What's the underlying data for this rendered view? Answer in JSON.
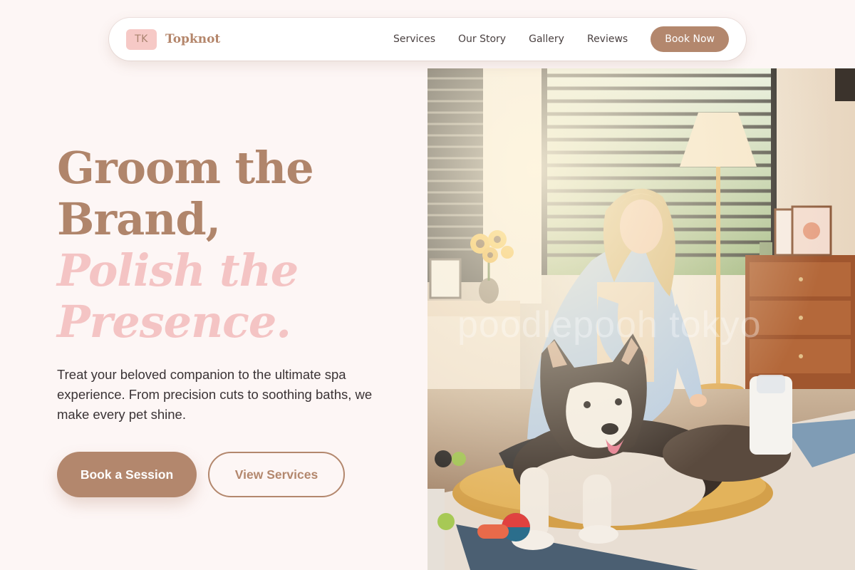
{
  "brand": {
    "badge": "TK",
    "name": "Topknot"
  },
  "nav": {
    "links": [
      "Services",
      "Our Story",
      "Gallery",
      "Reviews"
    ],
    "cta": "Book Now"
  },
  "hero": {
    "headline_line1": "Groom the",
    "headline_line2": "Brand,",
    "headline_line3": "Polish the",
    "headline_line4": "Presence.",
    "subtitle": "Treat your beloved companion to the ultimate spa experience. From precision cuts to soothing baths, we make every pet shine.",
    "primary_button": "Book a Session",
    "secondary_button": "View Services"
  },
  "image": {
    "watermark": "poodlepooh tokyo",
    "subject": "woman-grooming-husky-dog"
  },
  "colors": {
    "background": "#fdf6f5",
    "accent_brown": "#b3876d",
    "accent_pink": "#f4c4c4",
    "badge_pink": "#f6c9c6",
    "text_dark": "#3a3335"
  }
}
